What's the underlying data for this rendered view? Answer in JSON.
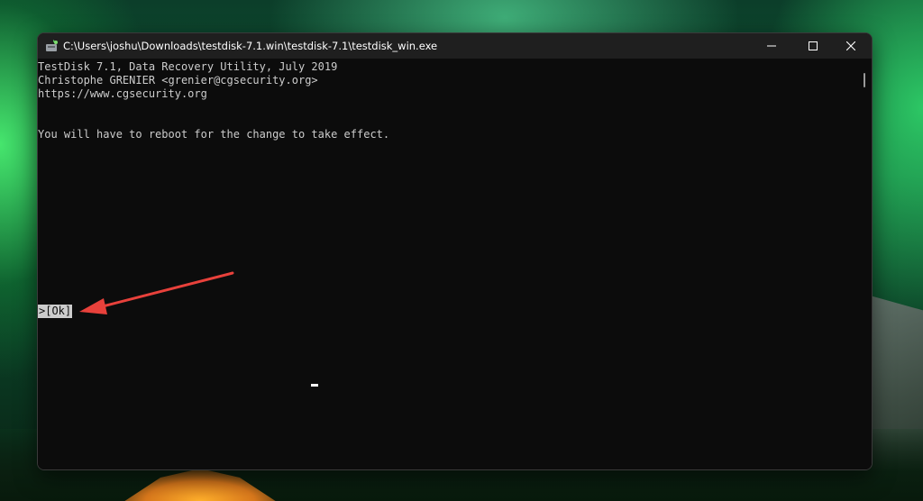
{
  "window": {
    "title": "C:\\Users\\joshu\\Downloads\\testdisk-7.1.win\\testdisk-7.1\\testdisk_win.exe",
    "icon": "testdisk-app-icon",
    "controls": {
      "minimize_icon": "minimize-icon",
      "maximize_icon": "maximize-icon",
      "close_icon": "close-icon"
    }
  },
  "terminal": {
    "header_lines": [
      "TestDisk 7.1, Data Recovery Utility, July 2019",
      "Christophe GRENIER <grenier@cgsecurity.org>",
      "https://www.cgsecurity.org"
    ],
    "message": "You will have to reboot for the change to take effect.",
    "ok_button": ">[Ok]"
  },
  "colors": {
    "terminal_background": "#0c0c0c",
    "terminal_text": "#cccccc",
    "titlebar_background": "#1f1f1f",
    "annotation_arrow": "#e8413b"
  }
}
